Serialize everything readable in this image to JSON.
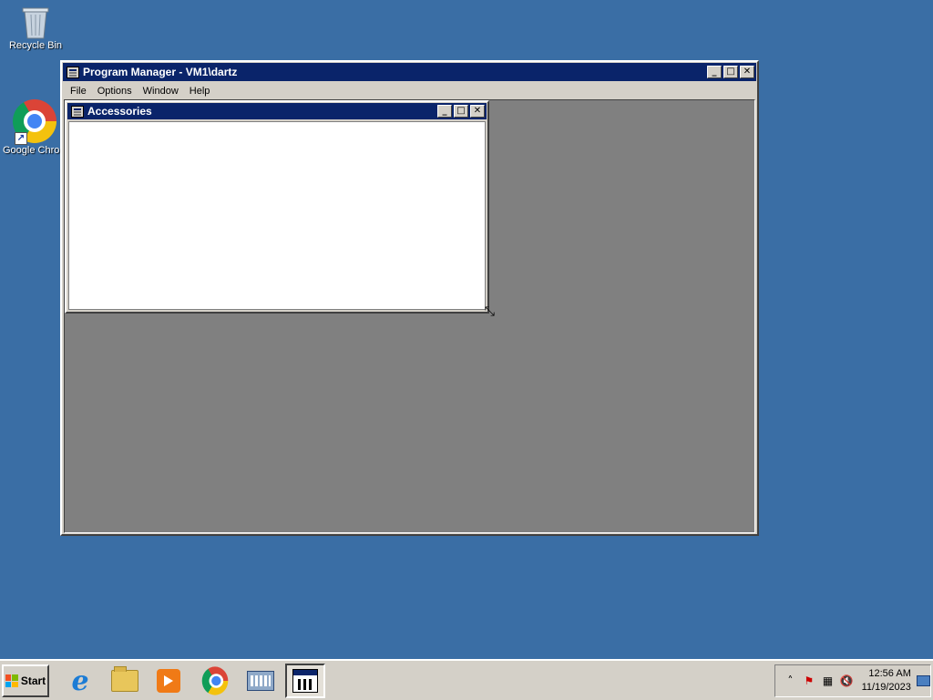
{
  "desktop": {
    "icons": [
      {
        "label": "Recycle Bin"
      },
      {
        "label": "Google Chrome"
      }
    ]
  },
  "program_manager": {
    "title": "Program Manager - VM1\\dartz",
    "menu": [
      "File",
      "Options",
      "Window",
      "Help"
    ],
    "caption_buttons": {
      "minimize": "_",
      "maximize": "□",
      "close": "✕"
    },
    "child_window": {
      "title": "Accessories"
    }
  },
  "taskbar": {
    "start_label": "Start",
    "apps": [
      {
        "icon": "internet-explorer-icon"
      },
      {
        "icon": "file-explorer-icon"
      },
      {
        "icon": "media-player-icon"
      },
      {
        "icon": "chrome-icon"
      },
      {
        "icon": "on-screen-keyboard-icon"
      },
      {
        "icon": "program-manager-icon",
        "active": true
      }
    ],
    "tray": {
      "overflow": "˄",
      "time": "12:56 AM",
      "date": "11/19/2023"
    }
  },
  "colors": {
    "desktop": "#3a6ea5",
    "title_active": "#0a246a",
    "mdi_background": "#808080",
    "face": "#d4d0c8"
  }
}
